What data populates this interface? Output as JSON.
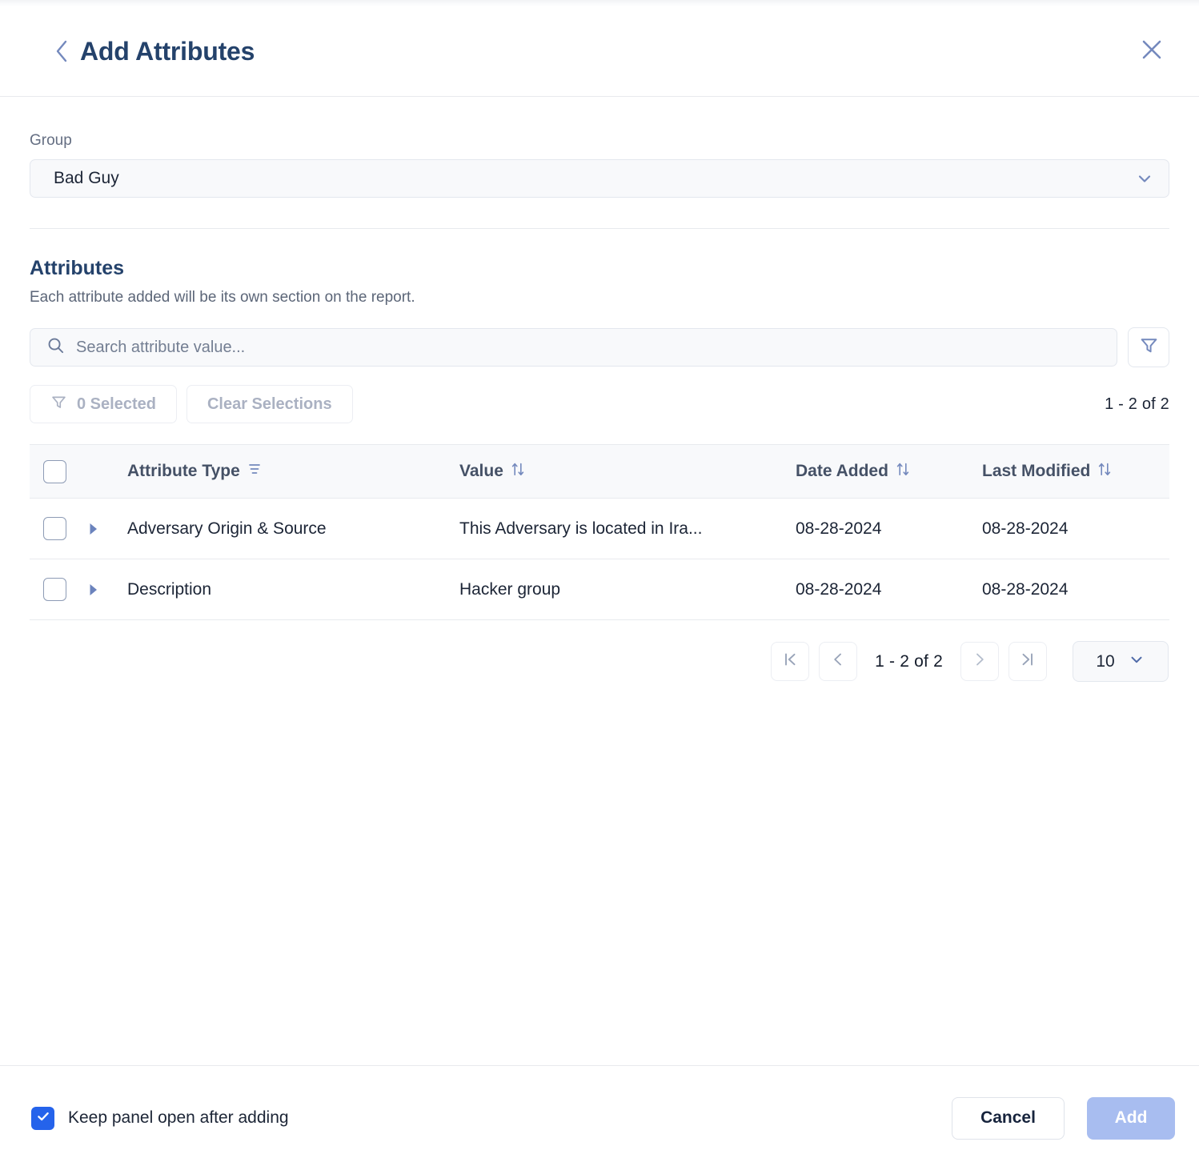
{
  "header": {
    "title": "Add Attributes",
    "back_icon": "chevron-left-icon",
    "close_icon": "close-icon"
  },
  "group": {
    "label": "Group",
    "value": "Bad Guy",
    "caret_icon": "chevron-down-icon"
  },
  "attributes": {
    "title": "Attributes",
    "subtitle": "Each attribute added will be its own section on the report.",
    "search": {
      "placeholder": "Search attribute value...",
      "value": "",
      "icon": "search-icon"
    },
    "filter_button_icon": "filter-icon",
    "selected_label": "0 Selected",
    "selected_icon": "filter-icon",
    "clear_label": "Clear Selections",
    "range_label": "1 - 2 of 2"
  },
  "table": {
    "columns": [
      {
        "key": "type",
        "label": "Attribute Type",
        "sort_icon": "sort-descending-icon"
      },
      {
        "key": "value",
        "label": "Value",
        "sort_icon": "sort-updown-icon"
      },
      {
        "key": "date_added",
        "label": "Date Added",
        "sort_icon": "sort-updown-icon"
      },
      {
        "key": "last_modified",
        "label": "Last Modified",
        "sort_icon": "sort-updown-icon"
      }
    ],
    "rows": [
      {
        "type": "Adversary Origin & Source",
        "value": "This Adversary is located in Ira...",
        "date_added": "08-28-2024",
        "last_modified": "08-28-2024",
        "expand_icon": "caret-right-icon",
        "checked": false
      },
      {
        "type": "Description",
        "value": "Hacker group",
        "date_added": "08-28-2024",
        "last_modified": "08-28-2024",
        "expand_icon": "caret-right-icon",
        "checked": false
      }
    ]
  },
  "pagination": {
    "first_icon": "page-first-icon",
    "prev_icon": "chevron-left-icon",
    "label": "1 - 2 of 2",
    "next_icon": "chevron-right-icon",
    "last_icon": "page-last-icon",
    "page_size": "10",
    "page_size_caret": "chevron-down-icon"
  },
  "footer": {
    "keep_open_label": "Keep panel open after adding",
    "keep_open_checked": true,
    "cancel_label": "Cancel",
    "add_label": "Add",
    "add_disabled": true
  },
  "colors": {
    "title_blue": "#24426b",
    "accent_blue": "#7489bd",
    "checkbox_blue": "#2563eb",
    "add_disabled_blue": "#a8bdf0",
    "text_dark": "#1c2536",
    "muted": "#aab1c2",
    "border": "#e8eaee",
    "field_bg": "#f8f9fb"
  }
}
